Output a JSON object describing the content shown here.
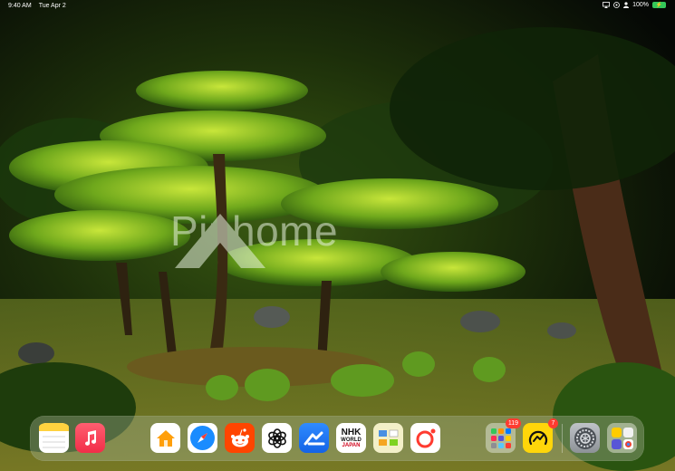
{
  "status_bar": {
    "time": "9:40 AM",
    "date": "Tue Apr 2",
    "battery_percent": "100%",
    "icons": [
      "screen-mirroring-icon",
      "focus-icon",
      "person-icon",
      "battery-icon"
    ]
  },
  "wallpaper": {
    "watermark_text": "Pinhome"
  },
  "dock": {
    "apps": [
      {
        "name": "Notes",
        "icon": "notes-icon"
      },
      {
        "name": "Music",
        "icon": "music-icon"
      },
      {
        "name": "Home",
        "icon": "home-icon"
      },
      {
        "name": "Safari",
        "icon": "safari-icon"
      },
      {
        "name": "Reddit",
        "icon": "reddit-icon"
      },
      {
        "name": "ChatGPT",
        "icon": "chatgpt-icon"
      },
      {
        "name": "Files",
        "icon": "files-app-icon"
      },
      {
        "name": "NHK World Japan",
        "icon": "nhk-world-icon",
        "lines": [
          "NHK",
          "WORLD",
          "JAPAN"
        ]
      },
      {
        "name": "Freeform",
        "icon": "freeform-icon"
      },
      {
        "name": "Screen Recorder",
        "icon": "record-icon"
      },
      {
        "name": "App Folder",
        "icon": "app-folder-icon",
        "badge": "119"
      },
      {
        "name": "Yellow App",
        "icon": "chart-app-icon",
        "badge": "7"
      },
      {
        "name": "Settings",
        "icon": "settings-icon"
      },
      {
        "name": "App Library",
        "icon": "app-library-icon"
      }
    ]
  },
  "colors": {
    "battery": "#34c759",
    "badge": "#ff3b30",
    "safari_blue": "#1a8cff",
    "reddit_orange": "#ff4500"
  }
}
